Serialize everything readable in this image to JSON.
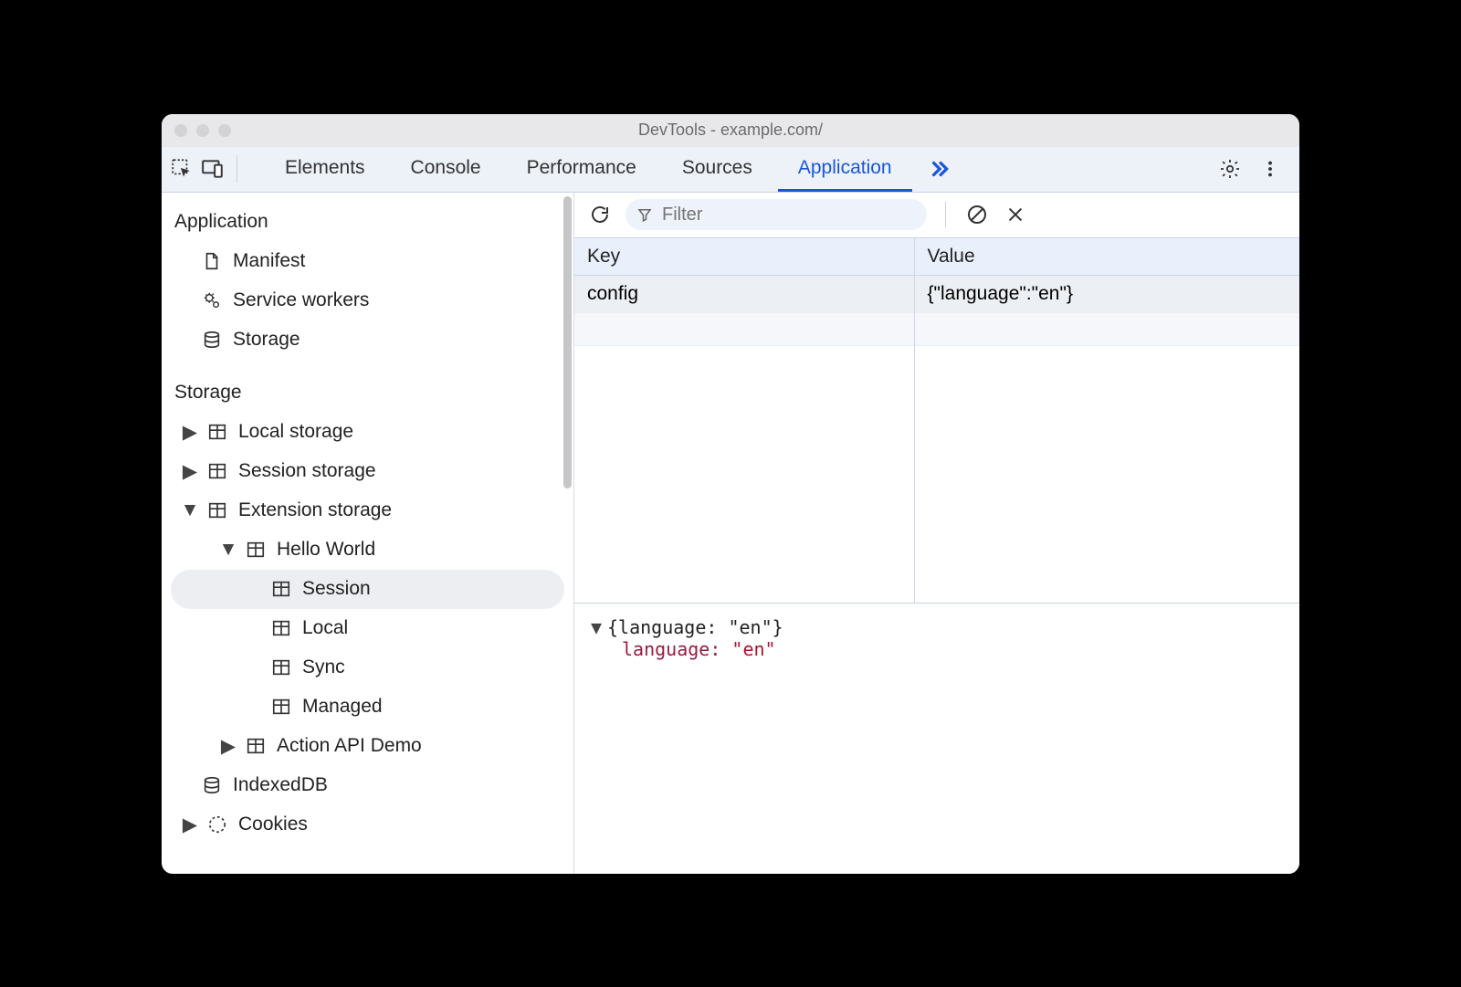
{
  "window": {
    "title": "DevTools - example.com/"
  },
  "tabs": [
    "Elements",
    "Console",
    "Performance",
    "Sources",
    "Application"
  ],
  "active_tab": "Application",
  "sidebar": {
    "section_application": "Application",
    "items_application": [
      {
        "label": "Manifest",
        "icon": "doc"
      },
      {
        "label": "Service workers",
        "icon": "gears"
      },
      {
        "label": "Storage",
        "icon": "db"
      }
    ],
    "section_storage": "Storage",
    "storage_tree": {
      "local_storage": "Local storage",
      "session_storage": "Session storage",
      "extension_storage": "Extension storage",
      "hello_world": "Hello World",
      "session": "Session",
      "local": "Local",
      "sync": "Sync",
      "managed": "Managed",
      "action_api_demo": "Action API Demo",
      "indexeddb": "IndexedDB",
      "cookies": "Cookies"
    }
  },
  "toolbar": {
    "filter_placeholder": "Filter"
  },
  "table": {
    "headers": {
      "key": "Key",
      "value": "Value"
    },
    "rows": [
      {
        "key": "config",
        "value": "{\"language\":\"en\"}"
      }
    ]
  },
  "preview": {
    "summary": "{language: \"en\"}",
    "prop_key": "language",
    "prop_value": "\"en\""
  }
}
